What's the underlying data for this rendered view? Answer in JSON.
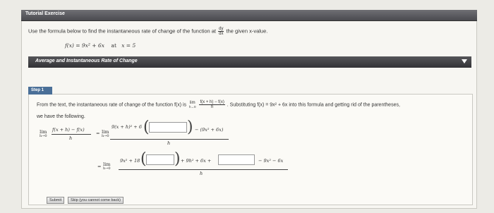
{
  "header": {
    "title": "Tutorial Exercise"
  },
  "instructions": {
    "text_before": "Use the formula below to find the instantaneous rate of change of the function at",
    "frac_num": "dy",
    "frac_den": "dx",
    "text_after": "the given x-value."
  },
  "given": {
    "function": "f(x) = 9x² + 6x",
    "at_label": "at",
    "x_value": "x = 5"
  },
  "section": {
    "title": "Average and Instantaneous Rate of Change"
  },
  "step": {
    "label": "Step 1",
    "text_a": "From the text, the instantaneous rate of change of the function f(x) is",
    "lim_word": "lim",
    "lim_sub": "h→0",
    "text_frac_num": "f(x + h) − f(x)",
    "text_frac_den": "h",
    "text_b": ". Substituting f(x) = 9x² + 6x into this formula and getting rid of the parentheses,",
    "text_c": "we have the following.",
    "row1": {
      "lhs_num": "f(x + h) − f(x)",
      "lhs_den": "h",
      "eq": "=",
      "rhs_num_start": "9(x + h)² + 6",
      "rhs_num_end": "− (9x² + 6x)",
      "rhs_den": "h"
    },
    "row2": {
      "eq": "=",
      "num_start": "9x² + 18",
      "num_mid": "+ 9h² + 6x +",
      "num_end": "− 9x² − 6x",
      "den": "h"
    }
  },
  "buttons": {
    "submit": "Submit",
    "skip": "Skip (you cannot come back)"
  },
  "colors": {
    "header_bar": "#5a5a5f",
    "section_bar": "#444447",
    "step_tag": "#4a6f98"
  }
}
